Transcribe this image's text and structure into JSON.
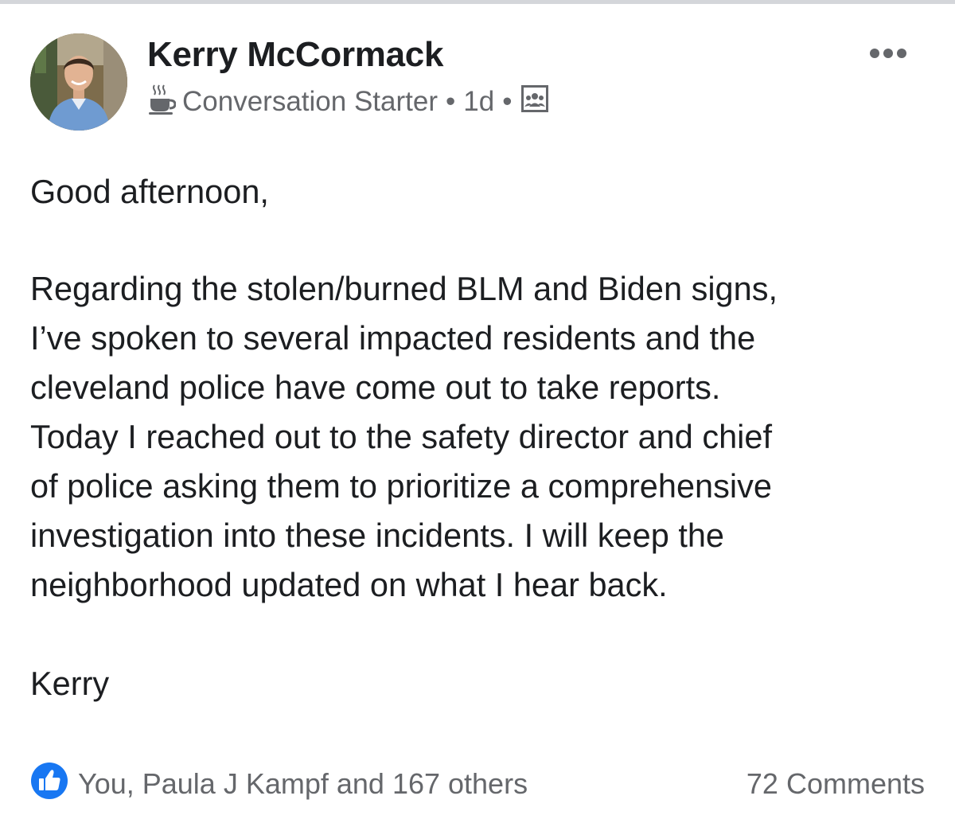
{
  "post": {
    "author_name": "Kerry McCormack",
    "badge_icon": "coffee-cup-icon",
    "badge_label": "Conversation Starter",
    "separator": "•",
    "timestamp": "1d",
    "audience_icon": "group-audience-icon",
    "more_icon": "more-options-icon",
    "body": {
      "greeting": "Good afternoon,",
      "paragraph": "Regarding the stolen/burned BLM and Biden signs,\nI’ve spoken to several impacted residents and the\ncleveland police have come out to take reports.\nToday I reached out to the safety director and chief\nof police asking them to prioritize a comprehensive\ninvestigation into these incidents. I will keep the\nneighborhood updated on what I hear back.",
      "signoff": "Kerry"
    }
  },
  "footer": {
    "reaction_icon": "like-thumb-icon",
    "reactions_text": "You, Paula J Kampf and 167 others",
    "comments_text": "72 Comments"
  },
  "colors": {
    "like_blue": "#1877f2",
    "meta_gray": "#65676b",
    "text": "#1c1e21"
  }
}
